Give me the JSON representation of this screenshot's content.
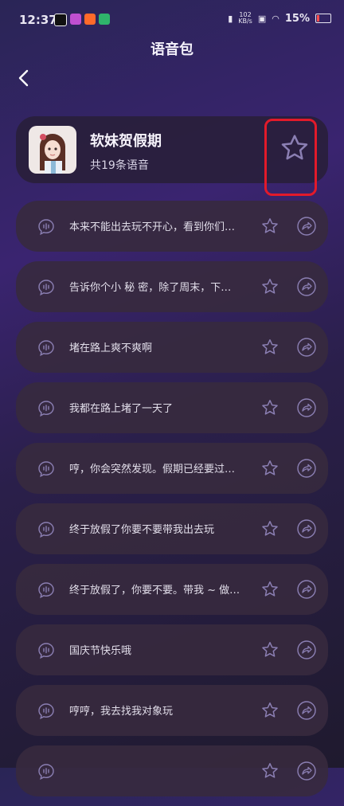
{
  "status_bar": {
    "time": "12:37",
    "network_speed_top": "102",
    "network_speed_bottom": "KB/s",
    "battery_percent": "15%"
  },
  "header": {
    "title": "语音包"
  },
  "pack": {
    "name": "软妹贺假期",
    "count_text": "共19条语音",
    "favorited": false
  },
  "voices": [
    {
      "text": "本来不能出去玩不开心，看到你们…"
    },
    {
      "text": "告诉你个小 秘 密，除了周末，下…"
    },
    {
      "text": "堵在路上爽不爽啊"
    },
    {
      "text": "我都在路上堵了一天了"
    },
    {
      "text": "哼，你会突然发现。假期已经要过…"
    },
    {
      "text": "终于放假了你要不要带我出去玩"
    },
    {
      "text": "终于放假了，你要不要。带我 ~ 做…"
    },
    {
      "text": "国庆节快乐哦"
    },
    {
      "text": "哼哼，我去找我对象玩"
    },
    {
      "text": ""
    }
  ],
  "colors": {
    "accent_icon": "#8b7fb3",
    "highlight": "#e21a2a"
  },
  "icons": [
    "back-icon",
    "star-icon",
    "voice-bubble-icon",
    "share-icon"
  ]
}
